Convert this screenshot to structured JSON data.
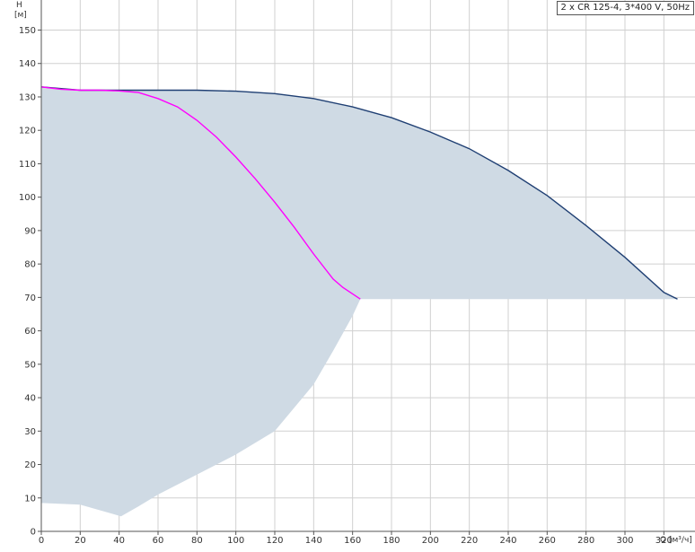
{
  "legend": {
    "label": "2 x CR 125-4, 3*400 V, 50Hz"
  },
  "axes": {
    "y_name": "H",
    "y_unit": "[м]",
    "x_name": "Q",
    "x_unit": "[м³/ч]"
  },
  "colors": {
    "grid": "#d0d0d0",
    "area_fill": "#cfdae4",
    "curve_main": "#1f3f73",
    "curve_secondary": "#ff00ff",
    "axis": "#555555"
  },
  "chart_data": {
    "type": "area",
    "xlim": [
      0,
      336
    ],
    "ylim": [
      0,
      159
    ],
    "grid": true,
    "legend_position": "top-right",
    "x_ticks": [
      0,
      20,
      40,
      60,
      80,
      100,
      120,
      140,
      160,
      180,
      200,
      220,
      240,
      260,
      280,
      300,
      320
    ],
    "y_ticks": [
      0,
      10,
      20,
      30,
      40,
      50,
      60,
      70,
      80,
      90,
      100,
      110,
      120,
      130,
      140,
      150
    ],
    "operating_area": {
      "upper": [
        [
          0,
          133
        ],
        [
          10,
          132.3
        ],
        [
          20,
          132
        ],
        [
          40,
          132
        ],
        [
          60,
          132
        ],
        [
          80,
          132
        ],
        [
          100,
          131.7
        ],
        [
          120,
          131.0
        ],
        [
          140,
          129.5
        ],
        [
          160,
          127.0
        ],
        [
          180,
          123.8
        ],
        [
          200,
          119.5
        ],
        [
          220,
          114.5
        ],
        [
          240,
          108.0
        ],
        [
          260,
          100.5
        ],
        [
          280,
          91.5
        ],
        [
          300,
          82.0
        ],
        [
          320,
          71.5
        ],
        [
          327,
          69.5
        ]
      ],
      "lower": [
        [
          164,
          69.5
        ],
        [
          160,
          64.5
        ],
        [
          150,
          54
        ],
        [
          140,
          44
        ],
        [
          130,
          37
        ],
        [
          120,
          30
        ],
        [
          100,
          23
        ],
        [
          80,
          17
        ],
        [
          60,
          11
        ],
        [
          50,
          7.5
        ],
        [
          41,
          4.5
        ],
        [
          20,
          8
        ],
        [
          0,
          8.5
        ]
      ]
    },
    "series": [
      {
        "points": [
          [
            0,
            133
          ],
          [
            20,
            132
          ],
          [
            40,
            132
          ],
          [
            60,
            132
          ],
          [
            80,
            132
          ],
          [
            100,
            131.7
          ],
          [
            120,
            131.0
          ],
          [
            140,
            129.5
          ],
          [
            160,
            127.0
          ],
          [
            180,
            123.8
          ],
          [
            200,
            119.5
          ],
          [
            220,
            114.5
          ],
          [
            240,
            108.0
          ],
          [
            260,
            100.5
          ],
          [
            280,
            91.5
          ],
          [
            300,
            82.0
          ],
          [
            320,
            71.5
          ],
          [
            327,
            69.5
          ]
        ]
      },
      {
        "points": [
          [
            0,
            133
          ],
          [
            10,
            132.3
          ],
          [
            20,
            132
          ],
          [
            30,
            132
          ],
          [
            40,
            131.8
          ],
          [
            50,
            131.3
          ],
          [
            60,
            129.5
          ],
          [
            70,
            127
          ],
          [
            80,
            123
          ],
          [
            90,
            118
          ],
          [
            100,
            112
          ],
          [
            110,
            105.5
          ],
          [
            120,
            98.5
          ],
          [
            130,
            91
          ],
          [
            140,
            83
          ],
          [
            150,
            75.5
          ],
          [
            155,
            73
          ],
          [
            164,
            69.5
          ]
        ]
      }
    ]
  }
}
